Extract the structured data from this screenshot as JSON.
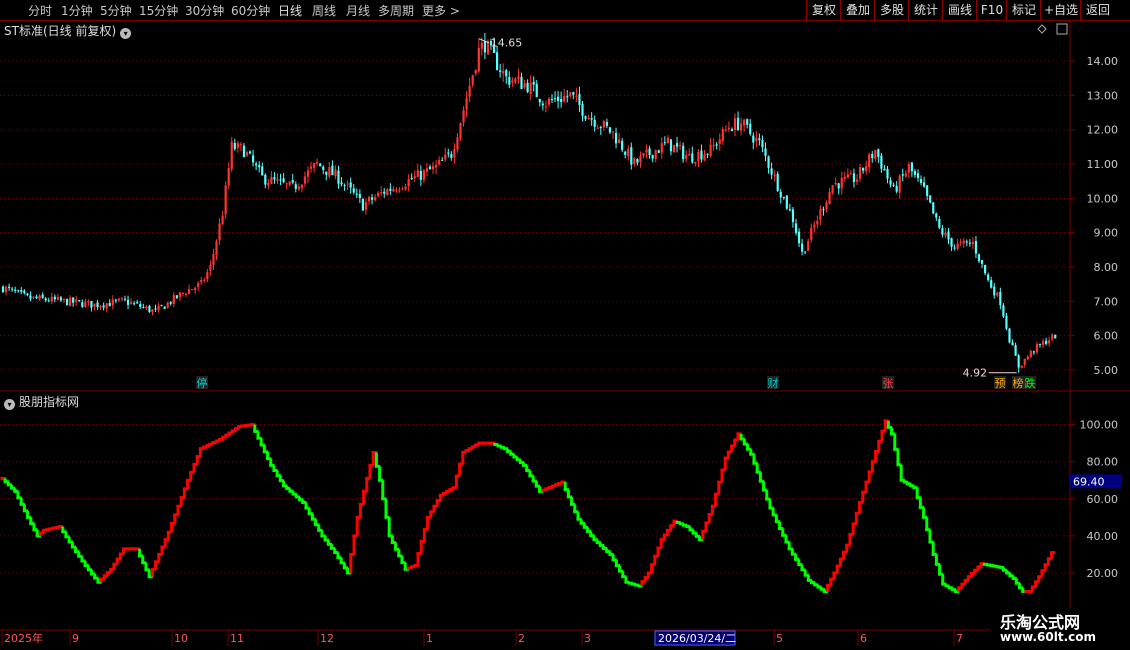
{
  "toolbar": {
    "periods": [
      "分时",
      "1分钟",
      "5分钟",
      "15分钟",
      "30分钟",
      "60分钟",
      "日线",
      "周线",
      "月线",
      "多周期",
      "更多"
    ],
    "active": "日线",
    "right": [
      "复权",
      "叠加",
      "多股",
      "统计",
      "画线",
      "F10",
      "标记",
      "+自选",
      "返回"
    ]
  },
  "main_panel": {
    "title": "ST标准(日线 前复权)",
    "high_label": "14.65",
    "low_label": "4.92"
  },
  "sub_panel": {
    "title": "股朋指标网",
    "value_tag": "69.40"
  },
  "markers": [
    {
      "text": "停",
      "color": "#00cccc"
    },
    {
      "text": "财",
      "color": "#00cccc"
    },
    {
      "text": "张",
      "color": "#ff4444"
    },
    {
      "text": "预",
      "color": "#ffaa00"
    },
    {
      "text": "榜",
      "color": "#ffaa00"
    },
    {
      "text": "跌",
      "color": "#00ff00"
    }
  ],
  "date_highlight": "2026/03/24/二",
  "watermark": {
    "name": "乐淘公式网",
    "url": "www.60lt.com"
  },
  "colors": {
    "up": "#ff3333",
    "down": "#54ffff",
    "ind_up": "#ff0000",
    "ind_down": "#00ff00",
    "grid": "#7a0000",
    "axis_text": "#c8c8c8"
  },
  "chart_data": [
    {
      "type": "candlestick",
      "title": "ST标准(日线 前复权)",
      "yticks": [
        5.0,
        6.0,
        7.0,
        8.0,
        9.0,
        10.0,
        11.0,
        12.0,
        13.0,
        14.0
      ],
      "ylim": [
        4.7,
        14.9
      ],
      "xticks": [
        "2025年",
        "9",
        "10",
        "11",
        "12",
        "1",
        "2",
        "3",
        "4",
        "5",
        "6",
        "7"
      ],
      "annotations": [
        {
          "text": "14.65",
          "value": 14.65
        },
        {
          "text": "4.92",
          "value": 4.92
        }
      ],
      "anchors": [
        [
          0,
          7.4
        ],
        [
          8,
          7.1
        ],
        [
          20,
          7.0
        ],
        [
          30,
          6.9
        ],
        [
          40,
          7.0
        ],
        [
          50,
          6.7
        ],
        [
          60,
          7.3
        ],
        [
          65,
          7.5
        ],
        [
          68,
          8.0
        ],
        [
          72,
          9.6
        ],
        [
          75,
          11.5
        ],
        [
          79,
          11.4
        ],
        [
          85,
          10.6
        ],
        [
          95,
          10.3
        ],
        [
          103,
          11.0
        ],
        [
          110,
          10.6
        ],
        [
          118,
          9.8
        ],
        [
          125,
          10.2
        ],
        [
          135,
          10.6
        ],
        [
          142,
          10.9
        ],
        [
          147,
          11.3
        ],
        [
          151,
          12.6
        ],
        [
          153,
          13.3
        ],
        [
          156,
          14.3
        ],
        [
          158,
          14.5
        ],
        [
          165,
          13.5
        ],
        [
          172,
          13.3
        ],
        [
          178,
          12.8
        ],
        [
          186,
          13.0
        ],
        [
          192,
          12.4
        ],
        [
          200,
          11.9
        ],
        [
          207,
          11.0
        ],
        [
          212,
          11.3
        ],
        [
          218,
          11.6
        ],
        [
          225,
          11.2
        ],
        [
          232,
          11.4
        ],
        [
          238,
          12.1
        ],
        [
          242,
          12.2
        ],
        [
          248,
          11.6
        ],
        [
          252,
          10.8
        ],
        [
          256,
          10.0
        ],
        [
          259,
          9.4
        ],
        [
          262,
          8.4
        ],
        [
          267,
          9.4
        ],
        [
          272,
          10.4
        ],
        [
          280,
          10.6
        ],
        [
          286,
          11.4
        ],
        [
          292,
          10.2
        ],
        [
          297,
          10.9
        ],
        [
          302,
          10.2
        ],
        [
          307,
          9.1
        ],
        [
          312,
          8.6
        ],
        [
          318,
          8.7
        ],
        [
          323,
          7.6
        ],
        [
          327,
          7.0
        ],
        [
          330,
          5.9
        ],
        [
          333,
          5.1
        ],
        [
          338,
          5.6
        ],
        [
          343,
          5.9
        ],
        [
          345,
          6.0
        ]
      ]
    },
    {
      "type": "line",
      "title": "股朋指标网",
      "yticks": [
        20.0,
        40.0,
        60.0,
        80.0,
        100.0
      ],
      "ylim": [
        10,
        103
      ],
      "last_value": 69.4,
      "anchors": [
        [
          0,
          71
        ],
        [
          4,
          64
        ],
        [
          8,
          50
        ],
        [
          11,
          40
        ],
        [
          13,
          43
        ],
        [
          18,
          45
        ],
        [
          22,
          34
        ],
        [
          26,
          24
        ],
        [
          30,
          15
        ],
        [
          34,
          22
        ],
        [
          38,
          33
        ],
        [
          42,
          33
        ],
        [
          46,
          18
        ],
        [
          52,
          42
        ],
        [
          58,
          70
        ],
        [
          62,
          87
        ],
        [
          68,
          92
        ],
        [
          74,
          99
        ],
        [
          78,
          100
        ],
        [
          84,
          78
        ],
        [
          88,
          67
        ],
        [
          94,
          58
        ],
        [
          100,
          40
        ],
        [
          104,
          31
        ],
        [
          108,
          20
        ],
        [
          111,
          50
        ],
        [
          116,
          85
        ],
        [
          118,
          70
        ],
        [
          121,
          40
        ],
        [
          126,
          22
        ],
        [
          129,
          24
        ],
        [
          133,
          50
        ],
        [
          137,
          62
        ],
        [
          141,
          66
        ],
        [
          144,
          85
        ],
        [
          149,
          90
        ],
        [
          153,
          90
        ],
        [
          157,
          87
        ],
        [
          163,
          78
        ],
        [
          168,
          64
        ],
        [
          175,
          69
        ],
        [
          180,
          49
        ],
        [
          185,
          38
        ],
        [
          190,
          30
        ],
        [
          195,
          15
        ],
        [
          199,
          13
        ],
        [
          202,
          20
        ],
        [
          206,
          38
        ],
        [
          210,
          48
        ],
        [
          214,
          45
        ],
        [
          218,
          38
        ],
        [
          222,
          56
        ],
        [
          226,
          82
        ],
        [
          230,
          95
        ],
        [
          234,
          84
        ],
        [
          240,
          55
        ],
        [
          246,
          33
        ],
        [
          252,
          16
        ],
        [
          257,
          10
        ],
        [
          260,
          20
        ],
        [
          264,
          35
        ],
        [
          268,
          58
        ],
        [
          272,
          80
        ],
        [
          276,
          102
        ],
        [
          278,
          95
        ],
        [
          281,
          70
        ],
        [
          285,
          66
        ],
        [
          288,
          50
        ],
        [
          291,
          30
        ],
        [
          294,
          14
        ],
        [
          298,
          10
        ],
        [
          302,
          18
        ],
        [
          306,
          25
        ],
        [
          312,
          23
        ],
        [
          316,
          17
        ],
        [
          320,
          7
        ],
        [
          324,
          18
        ],
        [
          328,
          31
        ]
      ]
    }
  ]
}
